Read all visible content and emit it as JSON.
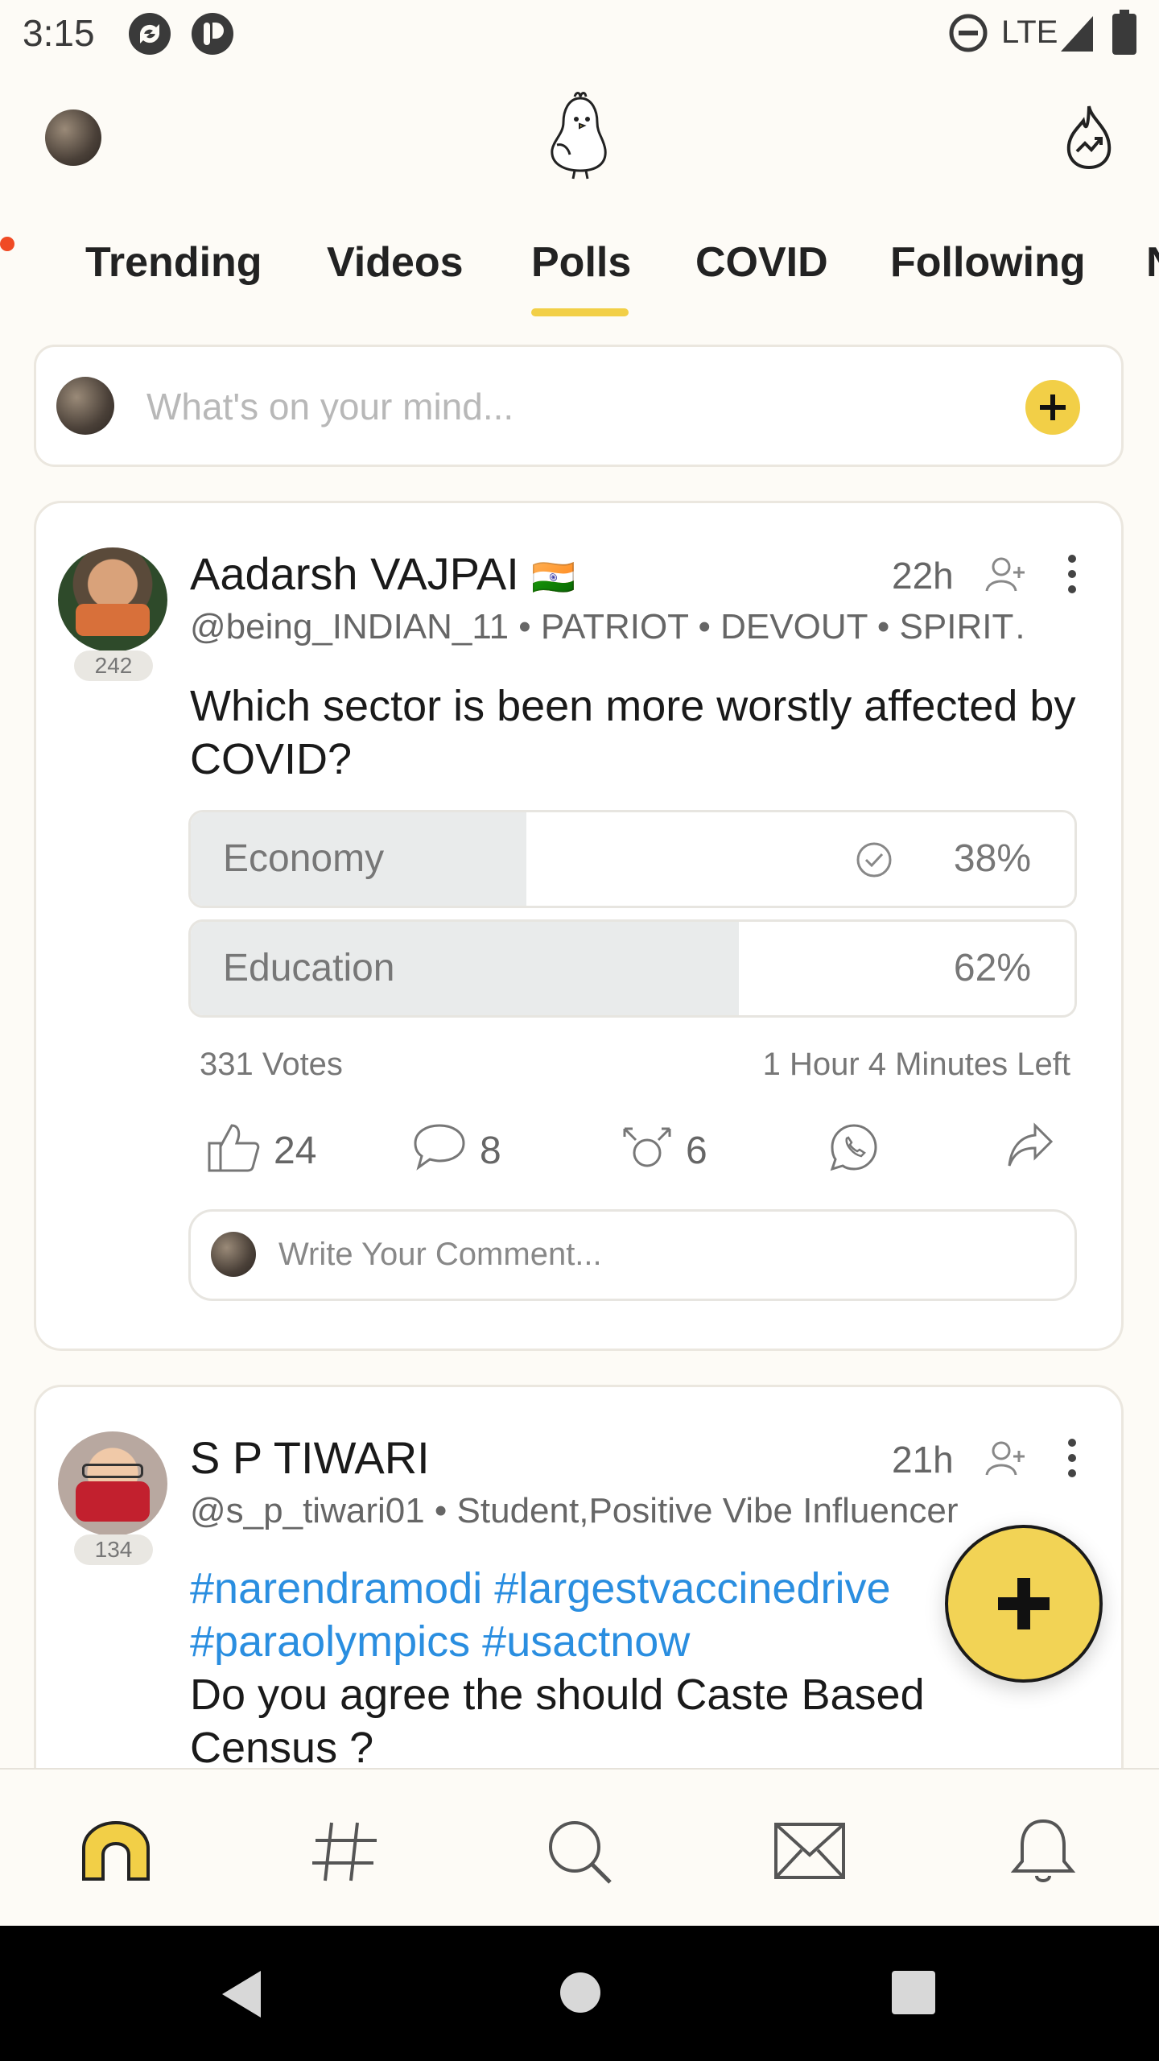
{
  "status_bar": {
    "time": "3:15",
    "network": "LTE"
  },
  "tabs": [
    {
      "label": "Trending"
    },
    {
      "label": "Videos"
    },
    {
      "label": "Polls"
    },
    {
      "label": "COVID"
    },
    {
      "label": "Following"
    },
    {
      "label": "N"
    }
  ],
  "composer": {
    "placeholder": "What's on your mind..."
  },
  "posts": [
    {
      "author": "Aadarsh VAJPAI",
      "flag": "🇮🇳",
      "meta": "@being_INDIAN_11 • PATRIOT • DEVOUT • SPIRIT…",
      "time": "22h",
      "badge": "242",
      "question": "Which sector is been more worstly affected by COVID?",
      "poll": {
        "options": [
          {
            "label": "Economy",
            "percent": "38%",
            "fraction": 0.38,
            "voted": true
          },
          {
            "label": "Education",
            "percent": "62%",
            "fraction": 0.62,
            "voted": false
          }
        ],
        "votes": "331 Votes",
        "time_left": "1 Hour 4 Minutes Left"
      },
      "actions": {
        "likes": "24",
        "comments": "8",
        "reshares": "6"
      },
      "comment_placeholder": "Write Your Comment..."
    },
    {
      "author": "S P TIWARI",
      "meta": "@s_p_tiwari01 • Student,Positive Vibe Influencer",
      "time": "21h",
      "badge": "134",
      "hashtags_line1": "#narendramodi #largestvaccinedrive",
      "hashtags_line2": "#paraolympics #usactnow",
      "body": "Do you agree the should Caste Based Census ?"
    }
  ],
  "colors": {
    "accent": "#f2cf47",
    "hashtag": "#2a8ee0",
    "background": "#fdfbf6"
  },
  "icons": [
    "profile-avatar",
    "koo-bird-logo",
    "trending-flame-icon",
    "plus-icon",
    "add-user-icon",
    "more-vert-icon",
    "check-circle-icon",
    "thumbs-up-icon",
    "comment-icon",
    "reshare-icon",
    "whatsapp-icon",
    "share-icon",
    "home-icon",
    "hashtag-icon",
    "search-icon",
    "mail-icon",
    "bell-icon"
  ]
}
